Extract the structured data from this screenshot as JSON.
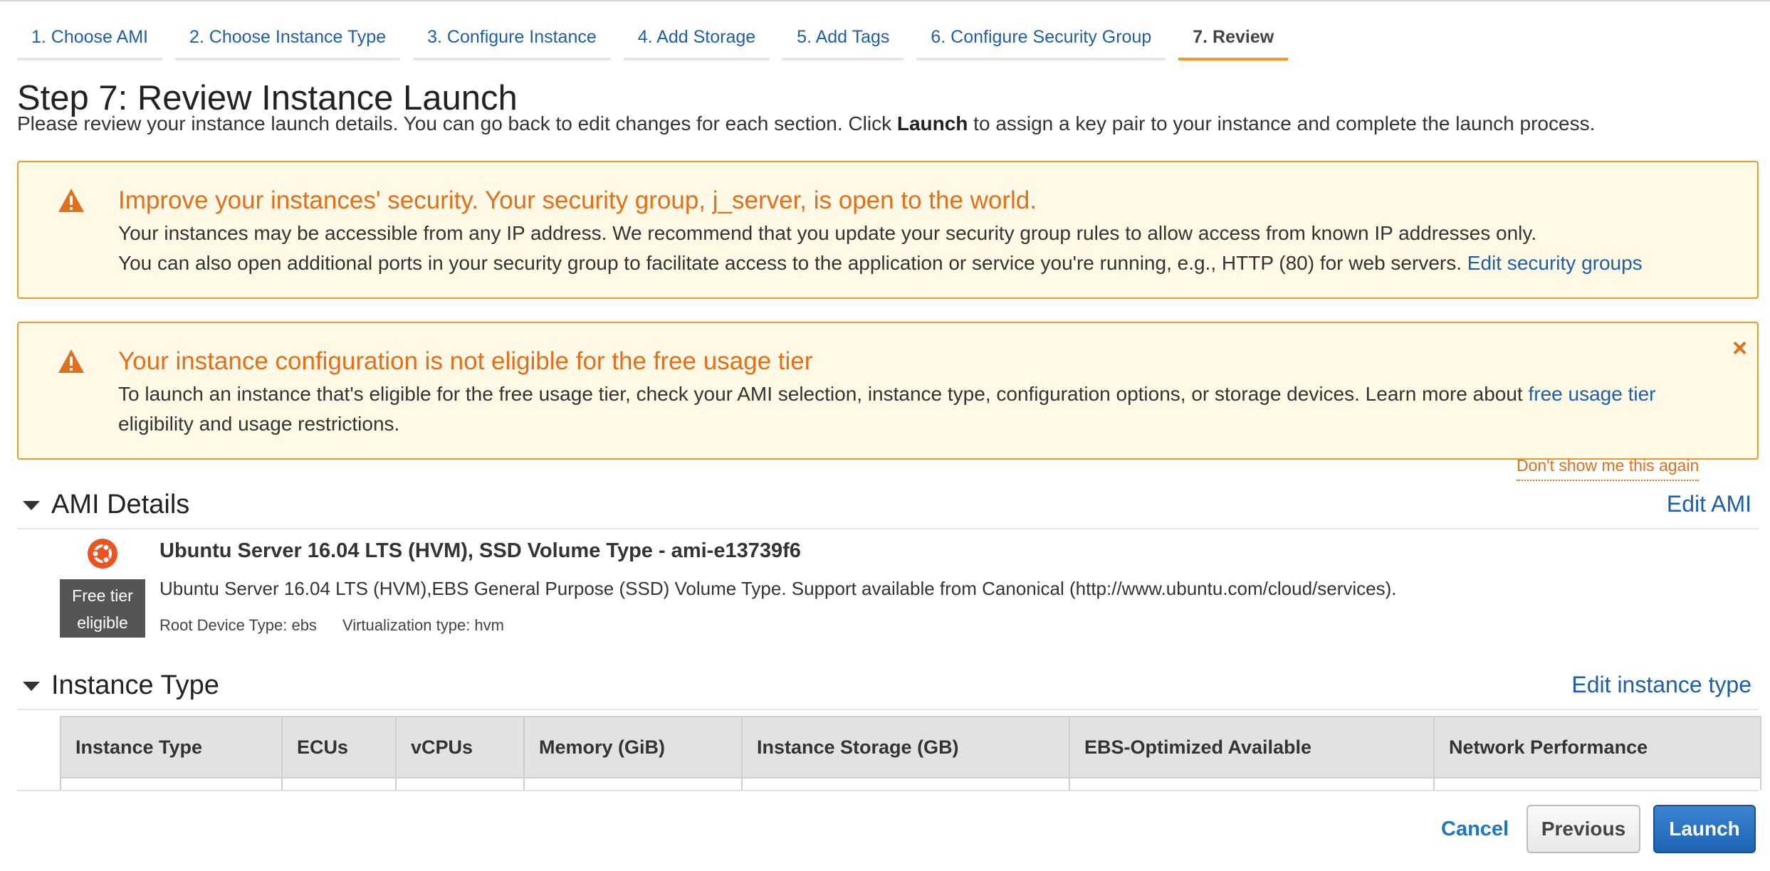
{
  "wizard": {
    "steps": [
      {
        "label": "1. Choose AMI"
      },
      {
        "label": "2. Choose Instance Type"
      },
      {
        "label": "3. Configure Instance"
      },
      {
        "label": "4. Add Storage"
      },
      {
        "label": "5. Add Tags"
      },
      {
        "label": "6. Configure Security Group"
      },
      {
        "label": "7. Review",
        "active": true
      }
    ]
  },
  "page": {
    "title": "Step 7: Review Instance Launch",
    "subtitle_before": "Please review your instance launch details. You can go back to edit changes for each section. Click ",
    "subtitle_bold": "Launch",
    "subtitle_after": " to assign a key pair to your instance and complete the launch process."
  },
  "security_warning": {
    "icon": "warning-icon",
    "title": "Improve your instances' security. Your security group, j_server, is open to the world.",
    "line1": "Your instances may be accessible from any IP address. We recommend that you update your security group rules to allow access from known IP addresses only.",
    "line2": "You can also open additional ports in your security group to facilitate access to the application or service you're running, e.g., HTTP (80) for web servers.",
    "link": "Edit security groups"
  },
  "free_tier_warning": {
    "icon": "warning-icon",
    "title": "Your instance configuration is not eligible for the free usage tier",
    "line1": "To launch an instance that's eligible for the free usage tier, check your AMI selection, instance type, configuration options, or storage devices. Learn more about",
    "link": "free usage tier",
    "line2": "eligibility and usage restrictions.",
    "close": "×",
    "dont_show": "Don't show me this again"
  },
  "ami_section": {
    "title": "AMI Details",
    "edit": "Edit AMI",
    "badge_line1": "Free tier",
    "badge_line2": "eligible",
    "name": "Ubuntu Server 16.04 LTS (HVM), SSD Volume Type - ami-e13739f6",
    "description": "Ubuntu Server 16.04 LTS (HVM),EBS General Purpose (SSD) Volume Type. Support available from Canonical (http://www.ubuntu.com/cloud/services).",
    "root_device": "Root Device Type: ebs",
    "virtualization": "Virtualization type: hvm"
  },
  "instance_section": {
    "title": "Instance Type",
    "edit": "Edit instance type",
    "columns": [
      "Instance Type",
      "ECUs",
      "vCPUs",
      "Memory (GiB)",
      "Instance Storage (GB)",
      "EBS-Optimized Available",
      "Network Performance"
    ]
  },
  "footer": {
    "cancel": "Cancel",
    "previous": "Previous",
    "launch": "Launch"
  },
  "colors": {
    "link": "#1f5fa8",
    "warning_title": "#e1701c",
    "warning_bg": "#fff9e6",
    "warning_border": "#eb9b2c",
    "active_tab_underline": "#f09b2a",
    "launch_button": "#1e62b3"
  }
}
